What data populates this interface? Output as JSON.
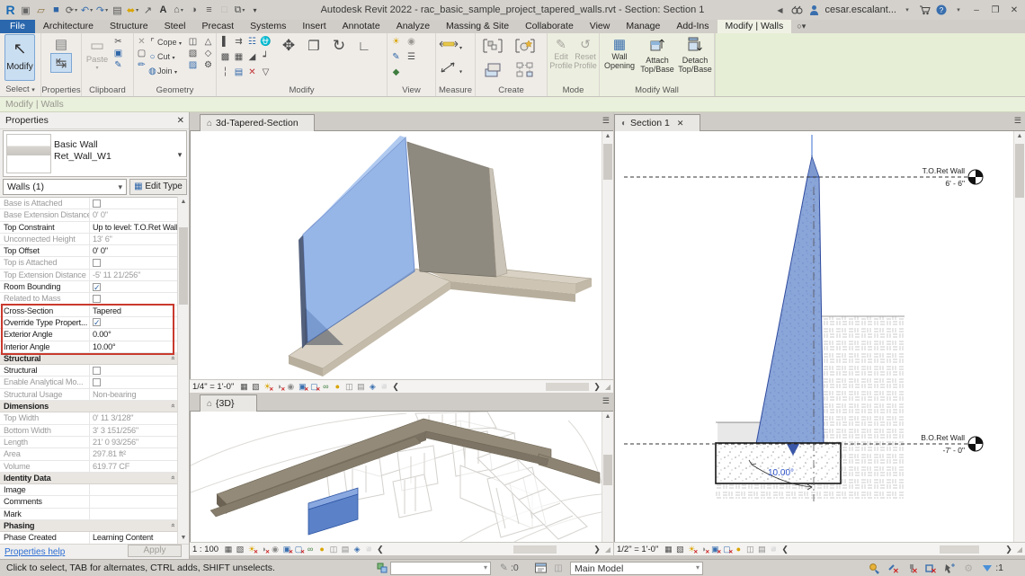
{
  "titlebar": {
    "title": "Autodesk Revit 2022 - rac_basic_sample_project_tapered_walls.rvt - Section: Section 1",
    "user": "cesar.escalant...",
    "qat_icons": [
      "revit-logo",
      "app-window",
      "open",
      "save",
      "sync",
      "undo",
      "redo",
      "print",
      "measure",
      "modify-pencil",
      "text-note",
      "default-3d-view",
      "section-view",
      "thin-lines",
      "inactive-tool",
      "switch-windows",
      "qat-menu"
    ],
    "right_icons": [
      "collapse-arrow",
      "search",
      "user-avatar"
    ]
  },
  "tabs": {
    "items": [
      "File",
      "Architecture",
      "Structure",
      "Steel",
      "Precast",
      "Systems",
      "Insert",
      "Annotate",
      "Analyze",
      "Massing & Site",
      "Collaborate",
      "View",
      "Manage",
      "Add-Ins",
      "Modify | Walls"
    ],
    "active": "Modify | Walls"
  },
  "ribbon": {
    "select_label": "Select",
    "modify_label": "Modify",
    "properties_label": "Properties",
    "paste_label": "Paste",
    "clipboard_label": "Clipboard",
    "cope_label": "Cope",
    "cut_label": "Cut",
    "join_label": "Join",
    "geometry_label": "Geometry",
    "modify_panel_label": "Modify",
    "view_label": "View",
    "measure_label": "Measure",
    "create_label": "Create",
    "edit_profile_label": "Edit Profile",
    "reset_profile_label": "Reset Profile",
    "mode_label": "Mode",
    "wall_opening_label": "Wall Opening",
    "attach_label": "Attach Top/Base",
    "detach_label": "Detach Top/Base",
    "modify_wall_label": "Modify Wall"
  },
  "optionbar": {
    "text": "Modify | Walls"
  },
  "properties": {
    "header": "Properties",
    "type_name": "Basic Wall",
    "type_instance": "Ret_Wall_W1",
    "selector": "Walls (1)",
    "edit_type": "Edit Type",
    "help": "Properties help",
    "apply": "Apply",
    "rows": [
      {
        "label": "Base is Attached",
        "type": "check",
        "dim": true
      },
      {
        "label": "Base Extension Distance",
        "value": "0'  0\"",
        "dim": true
      },
      {
        "label": "Top Constraint",
        "value": "Up to level: T.O.Ret Wall"
      },
      {
        "label": "Unconnected Height",
        "value": "13'  6\"",
        "dim": true
      },
      {
        "label": "Top Offset",
        "value": "0'  0\""
      },
      {
        "label": "Top is Attached",
        "type": "check",
        "dim": true
      },
      {
        "label": "Top Extension Distance",
        "value": "-5'  11 21/256\"",
        "dim": true
      },
      {
        "label": "Room Bounding",
        "type": "check-on"
      },
      {
        "label": "Related to Mass",
        "type": "check",
        "dim": true
      },
      {
        "label": "Cross-Section",
        "value": "Tapered",
        "red": "t"
      },
      {
        "label": "Override Type Propert...",
        "type": "check-on",
        "red": "m"
      },
      {
        "label": "Exterior Angle",
        "value": "0.00°",
        "red": "m"
      },
      {
        "label": "Interior Angle",
        "value": "10.00°",
        "red": "b"
      },
      {
        "header": "Structural"
      },
      {
        "label": "Structural",
        "type": "check"
      },
      {
        "label": "Enable Analytical Mo...",
        "type": "check",
        "dim": true
      },
      {
        "label": "Structural Usage",
        "value": "Non-bearing",
        "dim": true
      },
      {
        "header": "Dimensions"
      },
      {
        "label": "Top Width",
        "value": "0'  11 3/128\"",
        "dim": true
      },
      {
        "label": "Bottom Width",
        "value": "3'  3 151/256\"",
        "dim": true
      },
      {
        "label": "Length",
        "value": "21'  0 93/256\"",
        "dim": true
      },
      {
        "label": "Area",
        "value": "297.81 ft²",
        "dim": true
      },
      {
        "label": "Volume",
        "value": "619.77 CF",
        "dim": true
      },
      {
        "header": "Identity Data"
      },
      {
        "label": "Image",
        "value": ""
      },
      {
        "label": "Comments",
        "value": ""
      },
      {
        "label": "Mark",
        "value": ""
      },
      {
        "header": "Phasing"
      },
      {
        "label": "Phase Created",
        "value": "Learning Content"
      }
    ]
  },
  "views": {
    "tab_3d_tapered": "3d-Tapered-Section",
    "tab_3d": "{3D}",
    "tab_section": "Section 1",
    "scale_a": "1/4\" = 1'-0\"",
    "scale_b": "1 : 100",
    "scale_c": "1/2\" = 1'-0\"",
    "viewbar_icons": [
      "detail-level",
      "visual-style",
      "sun-path-off",
      "shadows-off",
      "show-rendering",
      "crop-view-off",
      "show-crop-off",
      "temporary-hide",
      "reveal-hidden",
      "temporary-view",
      "worksharing-display",
      "analytical-model",
      "constraints"
    ],
    "viewbar_icons_section": [
      "detail-level",
      "visual-style",
      "sun-path-off",
      "shadows-off",
      "crop-view",
      "show-crop",
      "reveal-hidden",
      "temporary-view",
      "worksharing-display",
      "constraints"
    ]
  },
  "section": {
    "top_level_name": "T.O.Ret Wall",
    "top_level_elev": "6' - 6\"",
    "bottom_level_name": "B.O.Ret Wall",
    "bottom_level_elev": "-7' - 0\"",
    "angle": "10.00°"
  },
  "statusbar": {
    "hint": "Click to select, TAB for alternates, CTRL adds, SHIFT unselects.",
    "editable_count": ":0",
    "main_model": "Main Model",
    "filter_count": ":1",
    "left_icons": [
      "worksets",
      "editable-only"
    ],
    "mid_icons": [
      "design-options-dialog",
      "design-options"
    ],
    "right_icons": [
      "active-only",
      "link-select-off",
      "pin-select-off",
      "exclusion-select-off",
      "select-by-face",
      "drag-elements",
      "filter"
    ]
  }
}
